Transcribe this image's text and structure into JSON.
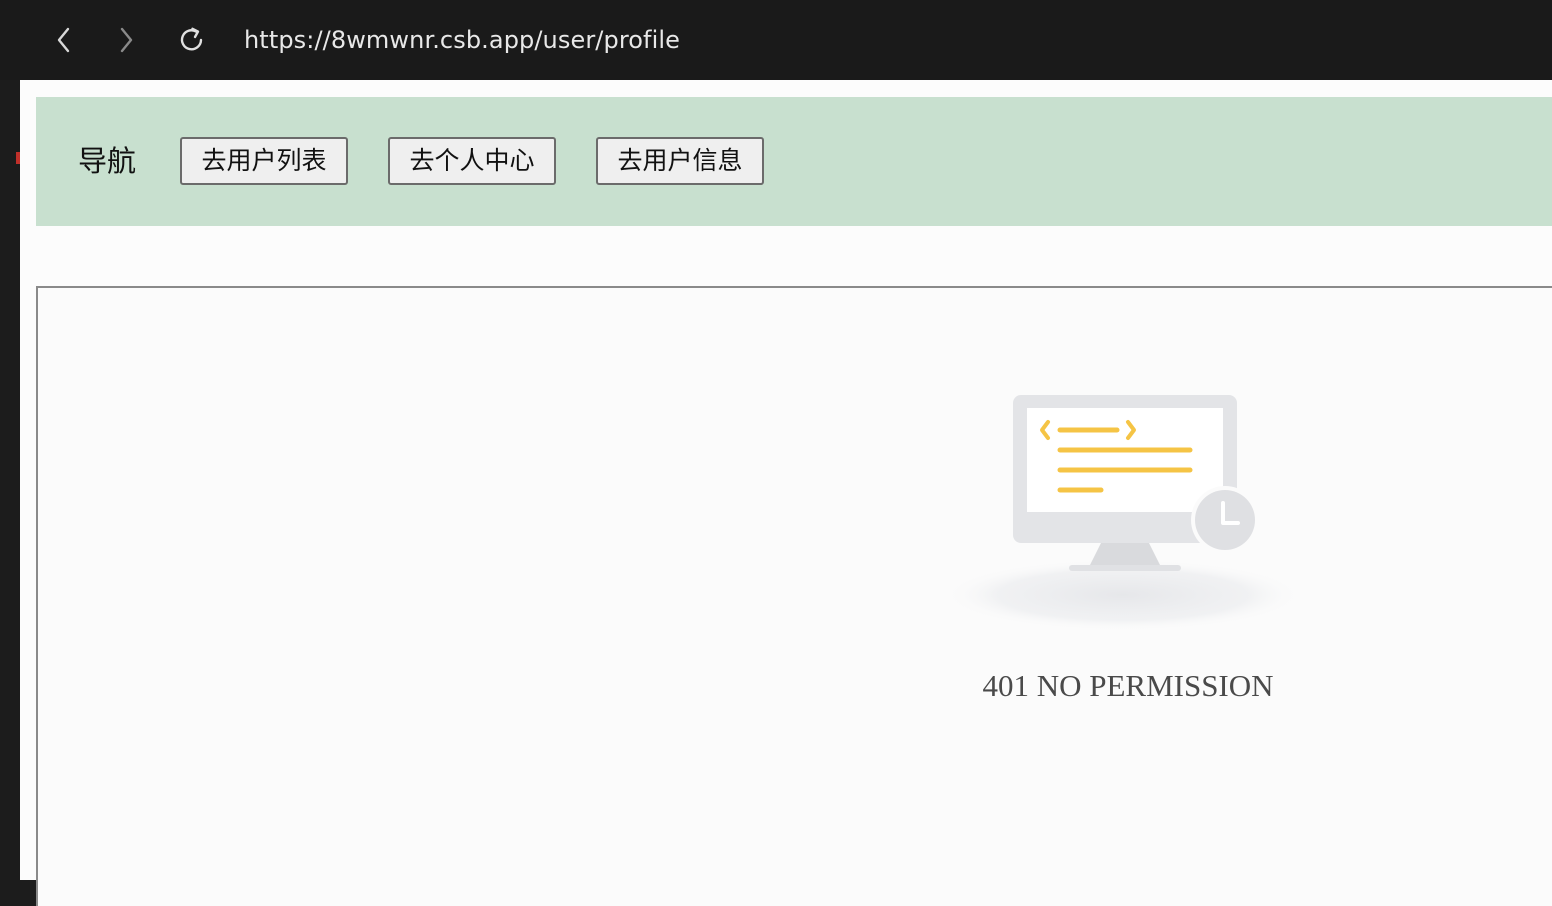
{
  "browser": {
    "url": "https://8wmwnr.csb.app/user/profile",
    "back_icon": "chevron-left-icon",
    "forward_icon": "chevron-right-icon",
    "reload_icon": "reload-icon"
  },
  "nav": {
    "label": "导航",
    "buttons": [
      {
        "label": "去用户列表"
      },
      {
        "label": "去个人中心"
      },
      {
        "label": "去用户信息"
      }
    ]
  },
  "error": {
    "message": "401 NO PERMISSION",
    "illustration_icon": "monitor-clock-icon"
  },
  "colors": {
    "nav_background": "#c8e0cf",
    "accent_yellow": "#f5c445",
    "monitor_gray": "#e2e3e6"
  }
}
